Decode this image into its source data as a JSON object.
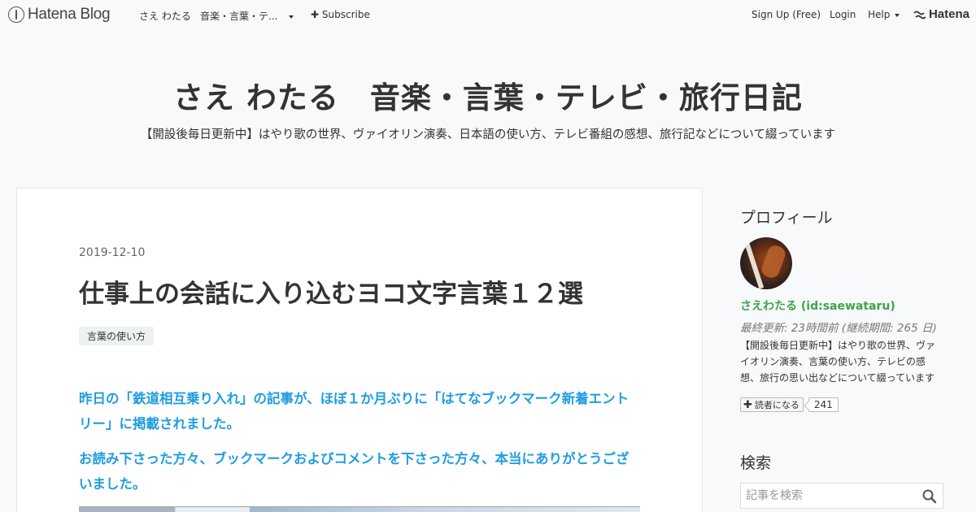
{
  "globalbar": {
    "logo_text": "Hatena Blog",
    "blog_link": "さえ わたる",
    "blog_menu": "音楽・言葉・テ...",
    "subscribe_label": "Subscribe",
    "signup_label": "Sign Up (Free)",
    "login_label": "Login",
    "help_label": "Help",
    "hatena_logo_text": "Hatena"
  },
  "header": {
    "blog_title": "さえ わたる　音楽・言葉・テレビ・旅行日記",
    "description": "【開設後毎日更新中】はやり歌の世界、ヴァイオリン演奏、日本語の使い方、テレビ番組の感想、旅行記などについて綴っています"
  },
  "article": {
    "date": "2019-12-10",
    "title": "仕事上の会話に入り込むヨコ文字言葉１２選",
    "category": "言葉の使い方",
    "paragraph1": "昨日の「鉄道相互乗り入れ」の記事が、ほぼ１か月ぶりに「はてなブックマーク新着エントリー」に掲載されました。",
    "paragraph2": "お読み下さった方々、ブックマークおよびコメントを下さった方々、本当にありがとうございました。",
    "accent_color": "#1f9de0"
  },
  "sidebar": {
    "profile_heading": "プロフィール",
    "profile_name": "さえわたる (id:saewataru)",
    "profile_updated": "最終更新: 23時間前 (継続期間: 265 日)",
    "profile_description": "【開設後毎日更新中】はやり歌の世界、ヴァイオリン演奏、言葉の使い方、テレビの感想、旅行の思い出などについて綴っています",
    "subscribe_button": "読者になる",
    "subscriber_count": "241",
    "search_heading": "検索",
    "search_placeholder": "記事を検索",
    "name_color": "#3aa44a"
  }
}
